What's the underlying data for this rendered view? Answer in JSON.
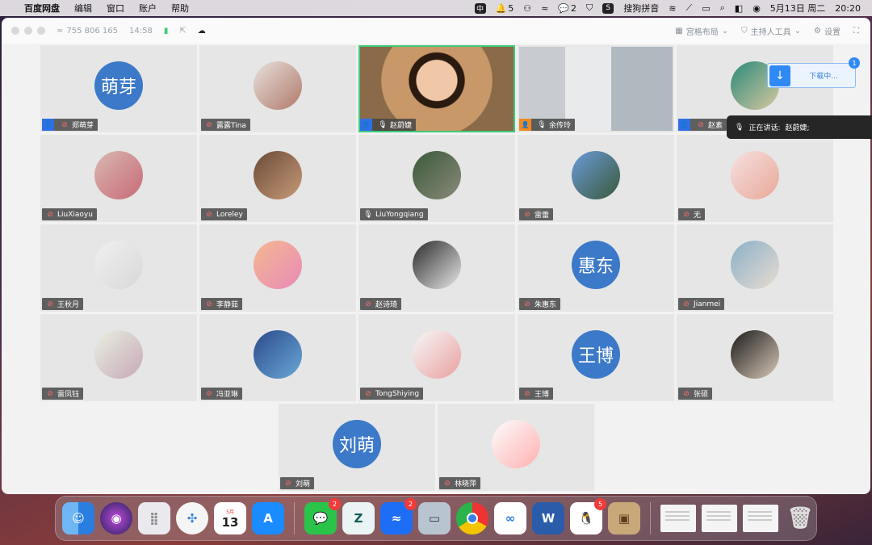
{
  "menubar": {
    "app_name": "百度网盘",
    "menus": [
      "编辑",
      "窗口",
      "账户",
      "帮助"
    ],
    "notification_count": "5",
    "wechat_count": "2",
    "input_method": "搜狗拼音",
    "date": "5月13日 周二",
    "time": "20:20"
  },
  "titlebar": {
    "meeting_id": "755 806 165",
    "elapsed": "14:58",
    "layout_label": "宫格布局",
    "host_tools_label": "主持人工具",
    "settings_label": "设置"
  },
  "download": {
    "label": "下载中...",
    "badge": "1"
  },
  "speaking": {
    "prefix": "正在讲话:",
    "name": "赵蔚婕;"
  },
  "participants": [
    {
      "name": "郑萌芽",
      "avatar_text": "萌芽",
      "host": true
    },
    {
      "name": "露露Tina"
    },
    {
      "name": "赵蔚婕",
      "host": true,
      "video": true,
      "active": true,
      "mic_on": true
    },
    {
      "name": "余传玲",
      "host": true,
      "host_color": "orange",
      "video": true,
      "mic_on": true
    },
    {
      "name": "赵素",
      "host": true
    },
    {
      "name": "LiuXiaoyu"
    },
    {
      "name": "Loreley"
    },
    {
      "name": "LiuYongqiang",
      "mic_on": true
    },
    {
      "name": "雷蕾"
    },
    {
      "name": "无"
    },
    {
      "name": "王秋月"
    },
    {
      "name": "李静茹"
    },
    {
      "name": "赵诗琦"
    },
    {
      "name": "朱惠东",
      "avatar_text": "惠东"
    },
    {
      "name": "Jianmei"
    },
    {
      "name": "雷凤钰"
    },
    {
      "name": "冯亚琳"
    },
    {
      "name": "TongShiying"
    },
    {
      "name": "王博",
      "avatar_text": "王博"
    },
    {
      "name": "张硕"
    },
    {
      "name": "刘萌",
      "avatar_text": "刘萌"
    },
    {
      "name": "林晓萍"
    }
  ],
  "dock": {
    "calendar_month": "5月",
    "calendar_day": "13",
    "wechat_badge": "2",
    "lark_badge": "2",
    "qq_badge": "5"
  },
  "colors": {
    "avatar_blue": "#3c79c8",
    "active_border": "#3ecb7a",
    "host_blue": "#2f6fe4",
    "host_orange": "#f08a1c"
  }
}
